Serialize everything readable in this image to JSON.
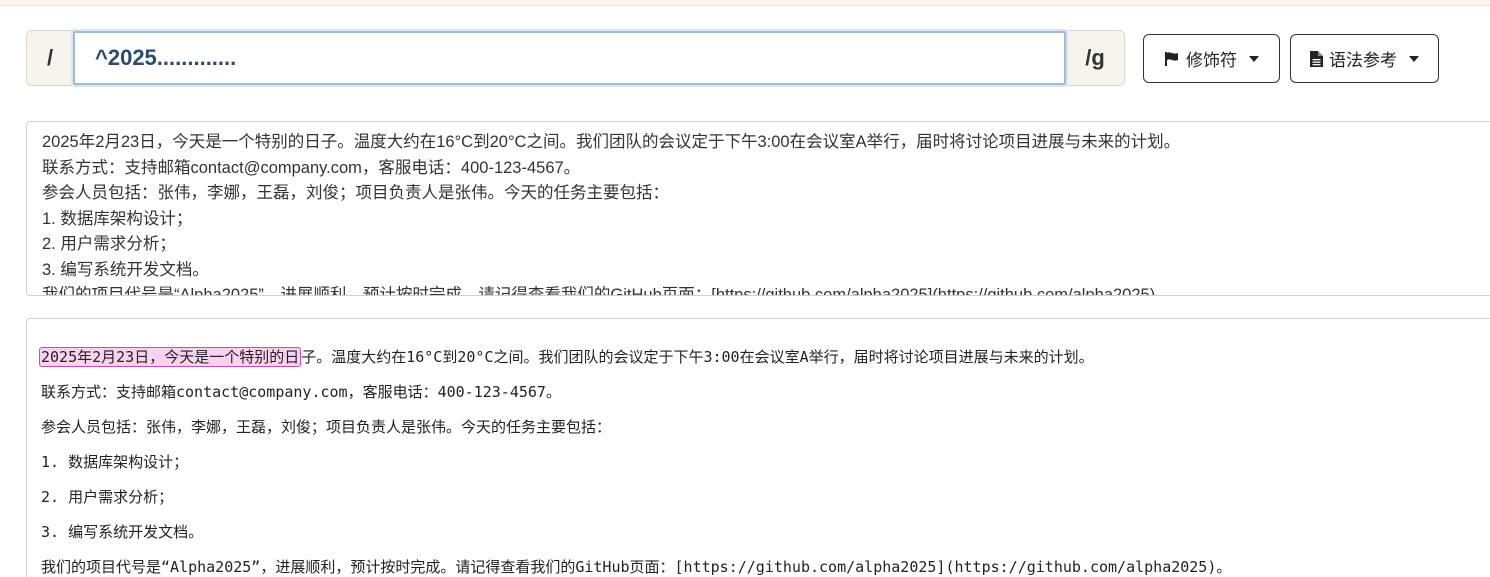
{
  "regex": {
    "prefix": "/",
    "value": "^2025.............",
    "suffix": "/g"
  },
  "buttons": {
    "modifiers_label": "修饰符",
    "syntax_label": "语法参考"
  },
  "source_lines": [
    "2025年2月23日，今天是一个特别的日子。温度大约在16°C到20°C之间。我们团队的会议定于下午3:00在会议室A举行，届时将讨论项目进展与未来的计划。",
    "联系方式：支持邮箱contact@company.com，客服电话：400-123-4567。",
    "参会人员包括：张伟，李娜，王磊，刘俊；项目负责人是张伟。今天的任务主要包括：",
    "1. 数据库架构设计；",
    "2. 用户需求分析；",
    "3. 编写系统开发文档。",
    "我们的项目代号是“Alpha2025”，进展顺利，预计按时完成。请记得查看我们的GitHub页面：[https://github.com/alpha2025](https://github.com/alpha2025)。"
  ],
  "result": {
    "match_text": "2025年2月23日，今天是一个特别的日",
    "first_line_rest": "子。温度大约在16°C到20°C之间。我们团队的会议定于下午3:00在会议室A举行，届时将讨论项目进展与未来的计划。",
    "lines": [
      "联系方式：支持邮箱contact@company.com，客服电话：400-123-4567。",
      "参会人员包括：张伟，李娜，王磊，刘俊；项目负责人是张伟。今天的任务主要包括：",
      "1. 数据库架构设计；",
      "2. 用户需求分析；",
      "3. 编写系统开发文档。",
      "我们的项目代号是“Alpha2025”，进展顺利，预计按时完成。请记得查看我们的GitHub页面：[https://github.com/alpha2025](https://github.com/alpha2025)。"
    ]
  },
  "icons": {
    "modifiers": "flag-icon",
    "syntax": "file-icon"
  }
}
